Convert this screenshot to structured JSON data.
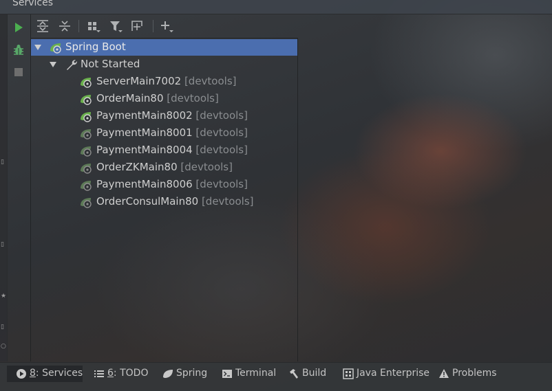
{
  "window": {
    "title": "Services"
  },
  "toolbar": {
    "buttons": [
      "expand-all",
      "collapse-all",
      "group-by",
      "filter",
      "new-tab",
      "add"
    ]
  },
  "left_actions": [
    "run",
    "debug",
    "stop"
  ],
  "tree": {
    "root": {
      "label": "Spring Boot"
    },
    "group": {
      "label": "Not Started"
    },
    "items": [
      {
        "name": "ServerMain7002",
        "tag": "[devtools]",
        "active": true
      },
      {
        "name": "OrderMain80",
        "tag": "[devtools]",
        "active": true
      },
      {
        "name": "PaymentMain8002",
        "tag": "[devtools]",
        "active": true
      },
      {
        "name": "PaymentMain8001",
        "tag": "[devtools]",
        "active": false
      },
      {
        "name": "PaymentMain8004",
        "tag": "[devtools]",
        "active": false
      },
      {
        "name": "OrderZKMain80",
        "tag": "[devtools]",
        "active": false
      },
      {
        "name": "PaymentMain8006",
        "tag": "[devtools]",
        "active": false
      },
      {
        "name": "OrderConsulMain80",
        "tag": "[devtools]",
        "active": false
      }
    ]
  },
  "bottom_tabs": [
    {
      "num": "8",
      "rest": ": Services",
      "icon": "play-circle-icon",
      "active": true
    },
    {
      "num": "6",
      "rest": ": TODO",
      "icon": "list-icon",
      "active": false
    },
    {
      "num": "",
      "rest": "Spring",
      "icon": "spring-leaf-icon",
      "active": false
    },
    {
      "num": "",
      "rest": "Terminal",
      "icon": "terminal-icon",
      "active": false
    },
    {
      "num": "",
      "rest": "Build",
      "icon": "hammer-icon",
      "active": false
    },
    {
      "num": "",
      "rest": "Java Enterprise",
      "icon": "java-enterprise-icon",
      "active": false
    },
    {
      "num": "",
      "rest": "Problems",
      "icon": "warning-icon",
      "active": false
    }
  ],
  "colors": {
    "selection": "#4b6eaf",
    "spring_green": "#6ab04c",
    "run_green": "#4caf50",
    "tag_gray": "#8a8d90"
  }
}
